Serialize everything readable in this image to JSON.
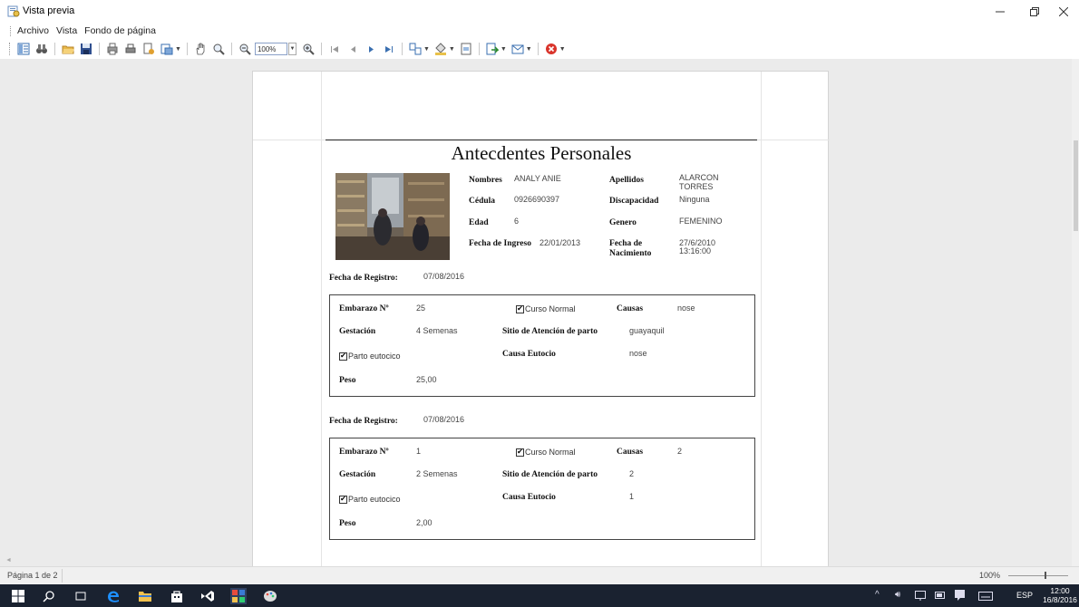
{
  "window": {
    "title": "Vista previa"
  },
  "menu": {
    "items": [
      "Archivo",
      "Vista",
      "Fondo de página"
    ]
  },
  "toolbar": {
    "zoom_value": "100%"
  },
  "report": {
    "title": "Antecdentes Personales",
    "personal": {
      "nombres_label": "Nombres",
      "nombres_value": "ANALY ANIE",
      "apellidos_label": "Apellidos",
      "apellidos_value_1": "ALARCON",
      "apellidos_value_2": "TORRES",
      "cedula_label": "Cédula",
      "cedula_value": "0926690397",
      "discapacidad_label": "Discapacidad",
      "discapacidad_value": "Ninguna",
      "edad_label": "Edad",
      "edad_value": "6",
      "genero_label": "Genero",
      "genero_value": "FEMENINO",
      "ingreso_label": "Fecha de Ingreso",
      "ingreso_value": "22/01/2013",
      "nacimiento_label_1": "Fecha de",
      "nacimiento_label_2": "Nacimiento",
      "nacimiento_value_1": "27/6/2010",
      "nacimiento_value_2": "13:16:00"
    },
    "labels": {
      "fecha_registro": "Fecha de Registro:",
      "embarazo": "Embarazo Nº",
      "curso_normal": "Curso Normal",
      "causas": "Causas",
      "gestacion": "Gestación",
      "sitio": "Sitio de Atención de parto",
      "parto": "Parto eutocico",
      "causa_eutocio": "Causa Eutocio",
      "peso": "Peso"
    },
    "records": [
      {
        "fecha_registro": "07/08/2016",
        "embarazo": "25",
        "curso_normal": true,
        "causas": "nose",
        "gestacion": "4 Semenas",
        "sitio": "guayaquil",
        "parto_eutocico": true,
        "causa_eutocio": "nose",
        "peso": "25,00"
      },
      {
        "fecha_registro": "07/08/2016",
        "embarazo": "1",
        "curso_normal": true,
        "causas": "2",
        "gestacion": "2 Semenas",
        "sitio": "2",
        "parto_eutocico": true,
        "causa_eutocio": "1",
        "peso": "2,00"
      }
    ]
  },
  "status": {
    "page": "Página 1 de 2",
    "zoom": "100%"
  },
  "taskbar": {
    "lang": "ESP",
    "time": "12:00",
    "date": "16/8/2016"
  },
  "colors": {
    "viewer_bg": "#ebebeb",
    "taskbar_bg": "#1a2230",
    "edge_blue": "#1e90ff"
  }
}
